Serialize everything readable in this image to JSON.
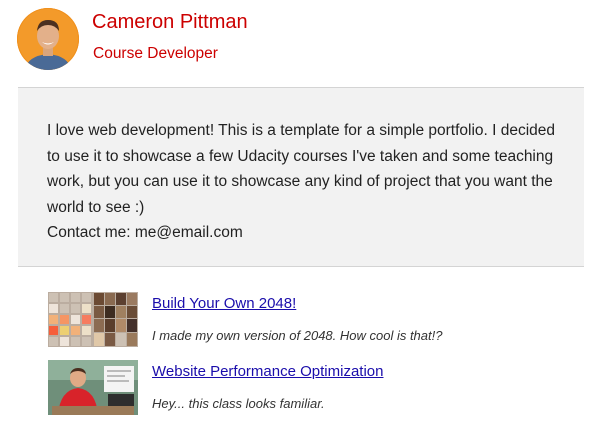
{
  "profile": {
    "name": "Cameron Pittman",
    "title": "Course Developer"
  },
  "bio": {
    "text": "I love web development! This is a template for a simple portfolio. I decided to use it to showcase a few Udacity courses I've taken and some teaching work, but you can use it to showcase any kind of project that you want the world to see :)",
    "contact": "Contact me: me@email.com"
  },
  "projects": [
    {
      "link_text": "Build Your Own 2048!",
      "description": "I made my own version of 2048. How cool is that!?",
      "thumbnail": "2048-game-thumbnail"
    },
    {
      "link_text": "Website Performance Optimization",
      "description": "Hey... this class looks familiar.",
      "thumbnail": "course-video-thumbnail"
    }
  ],
  "colors": {
    "accent": "#cc0000",
    "link": "#1a0dab",
    "bio_background": "#f2f2f2"
  }
}
